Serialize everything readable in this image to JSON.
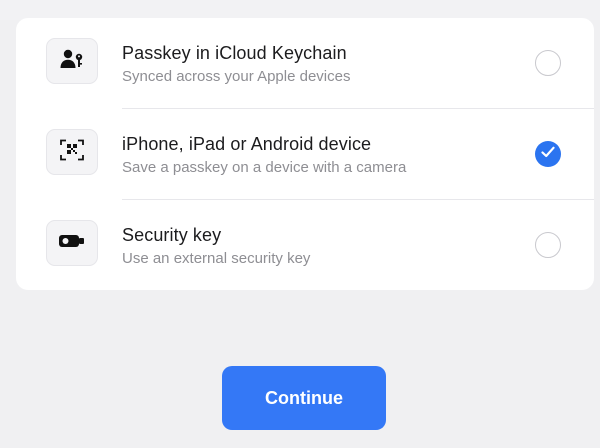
{
  "options": [
    {
      "icon": "person-key-icon",
      "title": "Passkey in iCloud Keychain",
      "subtitle": "Synced across your Apple devices",
      "selected": false
    },
    {
      "icon": "qr-code-scan-icon",
      "title": "iPhone, iPad or Android device",
      "subtitle": "Save a passkey on a device with a camera",
      "selected": true
    },
    {
      "icon": "security-key-icon",
      "title": "Security key",
      "subtitle": "Use an external security key",
      "selected": false
    }
  ],
  "continue_button": {
    "label": "Continue"
  },
  "colors": {
    "accent": "#3478f6",
    "background": "#f0f0f2",
    "card": "#ffffff",
    "title_text": "#1c1c1e",
    "subtitle_text": "#8e8e93"
  }
}
